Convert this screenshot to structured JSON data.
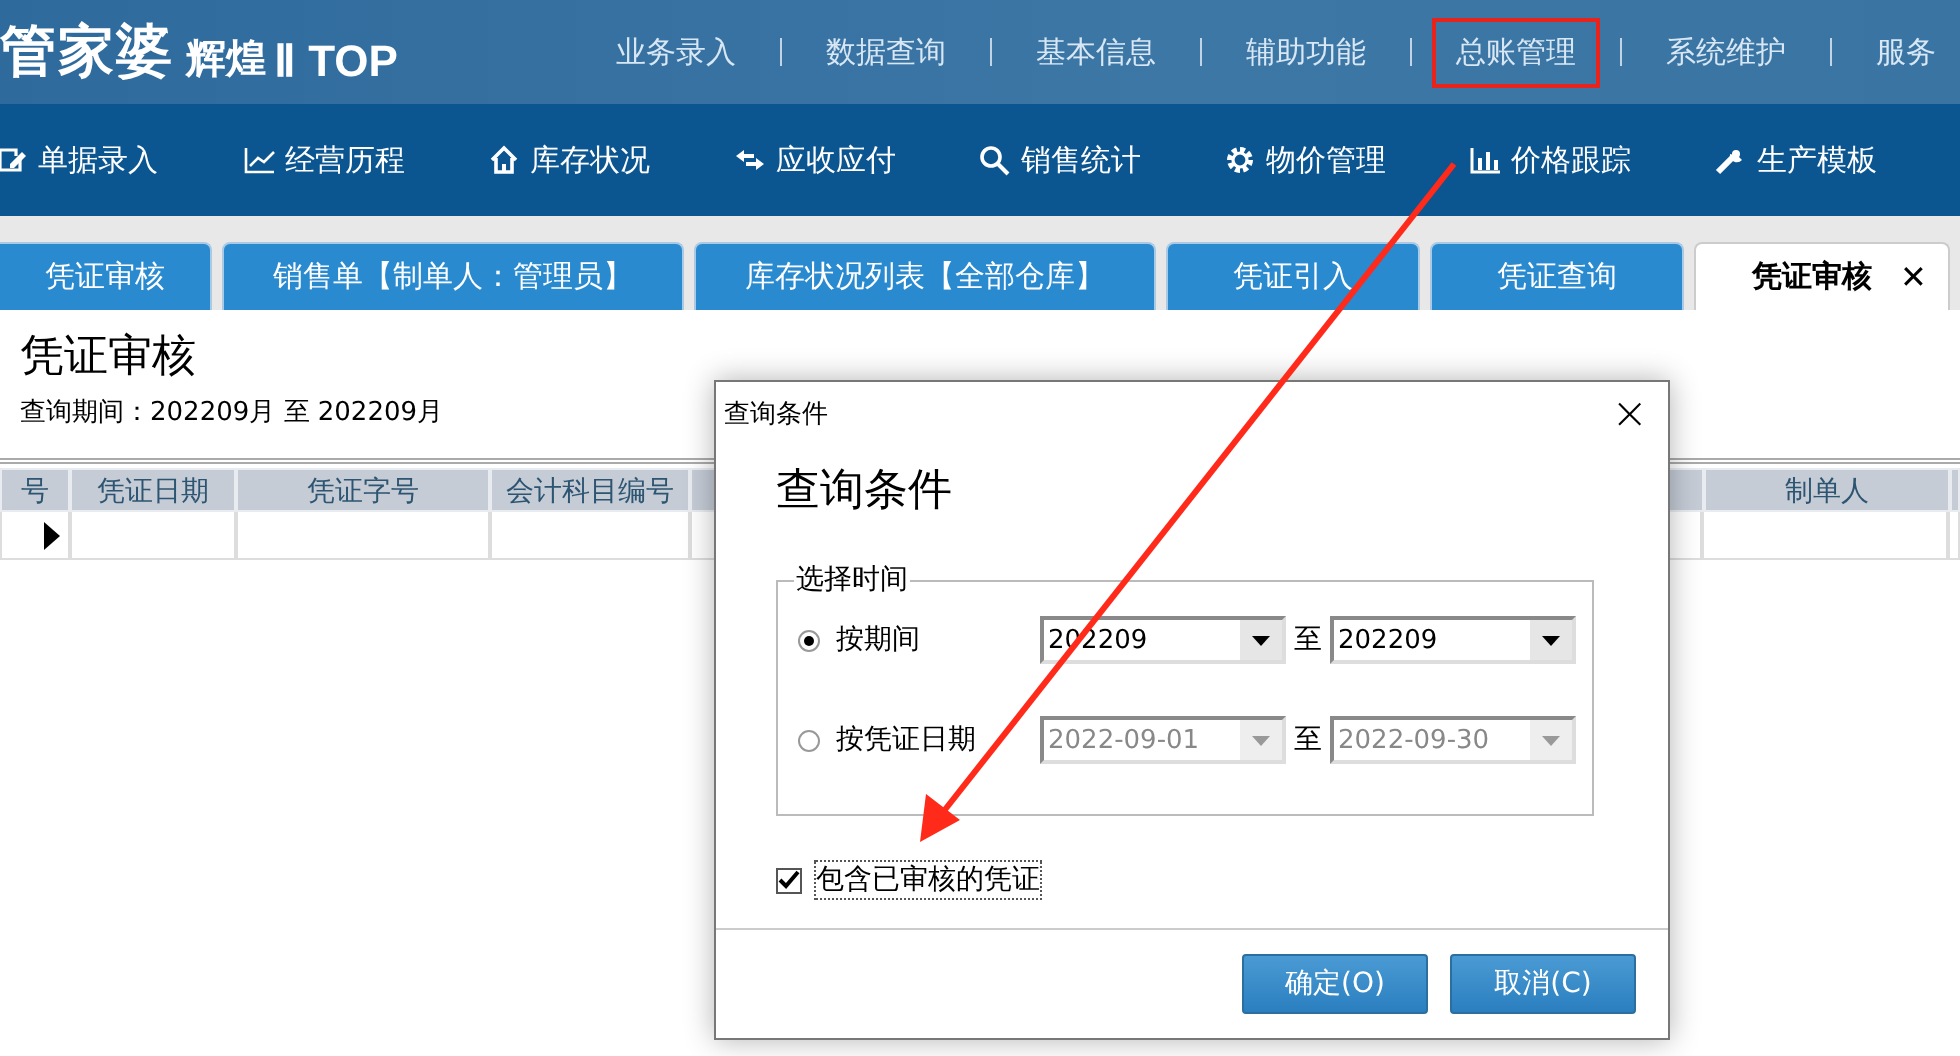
{
  "app": {
    "logo": "管家婆",
    "logo_sub": "辉煌",
    "logo_edition": "Ⅱ TOP"
  },
  "top_menu": [
    {
      "label": "业务录入",
      "highlighted": false
    },
    {
      "label": "数据查询",
      "highlighted": false
    },
    {
      "label": "基本信息",
      "highlighted": false
    },
    {
      "label": "辅助功能",
      "highlighted": false
    },
    {
      "label": "总账管理",
      "highlighted": true
    },
    {
      "label": "系统维护",
      "highlighted": false
    },
    {
      "label": "服务",
      "highlighted": false
    }
  ],
  "toolbar": [
    {
      "label": "单据录入"
    },
    {
      "label": "经营历程"
    },
    {
      "label": "库存状况"
    },
    {
      "label": "应收应付"
    },
    {
      "label": "销售统计"
    },
    {
      "label": "物价管理"
    },
    {
      "label": "价格跟踪"
    },
    {
      "label": "生产模板"
    }
  ],
  "tabs": [
    {
      "label": "凭证审核",
      "selected": false
    },
    {
      "label": "销售单【制单人：管理员】",
      "selected": false
    },
    {
      "label": "库存状况列表【全部仓库】",
      "selected": false
    },
    {
      "label": "凭证引入",
      "selected": false
    },
    {
      "label": "凭证查询",
      "selected": false
    },
    {
      "label": "凭证审核",
      "selected": true,
      "close": "✕"
    }
  ],
  "page": {
    "title": "凭证审核",
    "period": "查询期间：202209月 至 202209月"
  },
  "table": {
    "columns": [
      {
        "label": "号"
      },
      {
        "label": "凭证日期"
      },
      {
        "label": "凭证字号"
      },
      {
        "label": "会计科目编号"
      },
      {},
      {
        "label": "制单人"
      }
    ],
    "rows": [
      {
        "current": true
      }
    ]
  },
  "dialog": {
    "title": "查询条件",
    "close": "×",
    "heading": "查询条件",
    "group": "选择时间",
    "options": [
      {
        "label": "按期间",
        "selected": true,
        "disabled": false,
        "from": "202209",
        "sep": "至",
        "to": "202209"
      },
      {
        "label": "按凭证日期",
        "selected": false,
        "disabled": true,
        "from": "2022-09-01",
        "sep": "至",
        "to": "2022-09-30"
      }
    ],
    "checkbox": {
      "label": "包含已审核的凭证",
      "checked": true
    },
    "buttons": [
      "确定(O)",
      "取消(C)"
    ]
  }
}
